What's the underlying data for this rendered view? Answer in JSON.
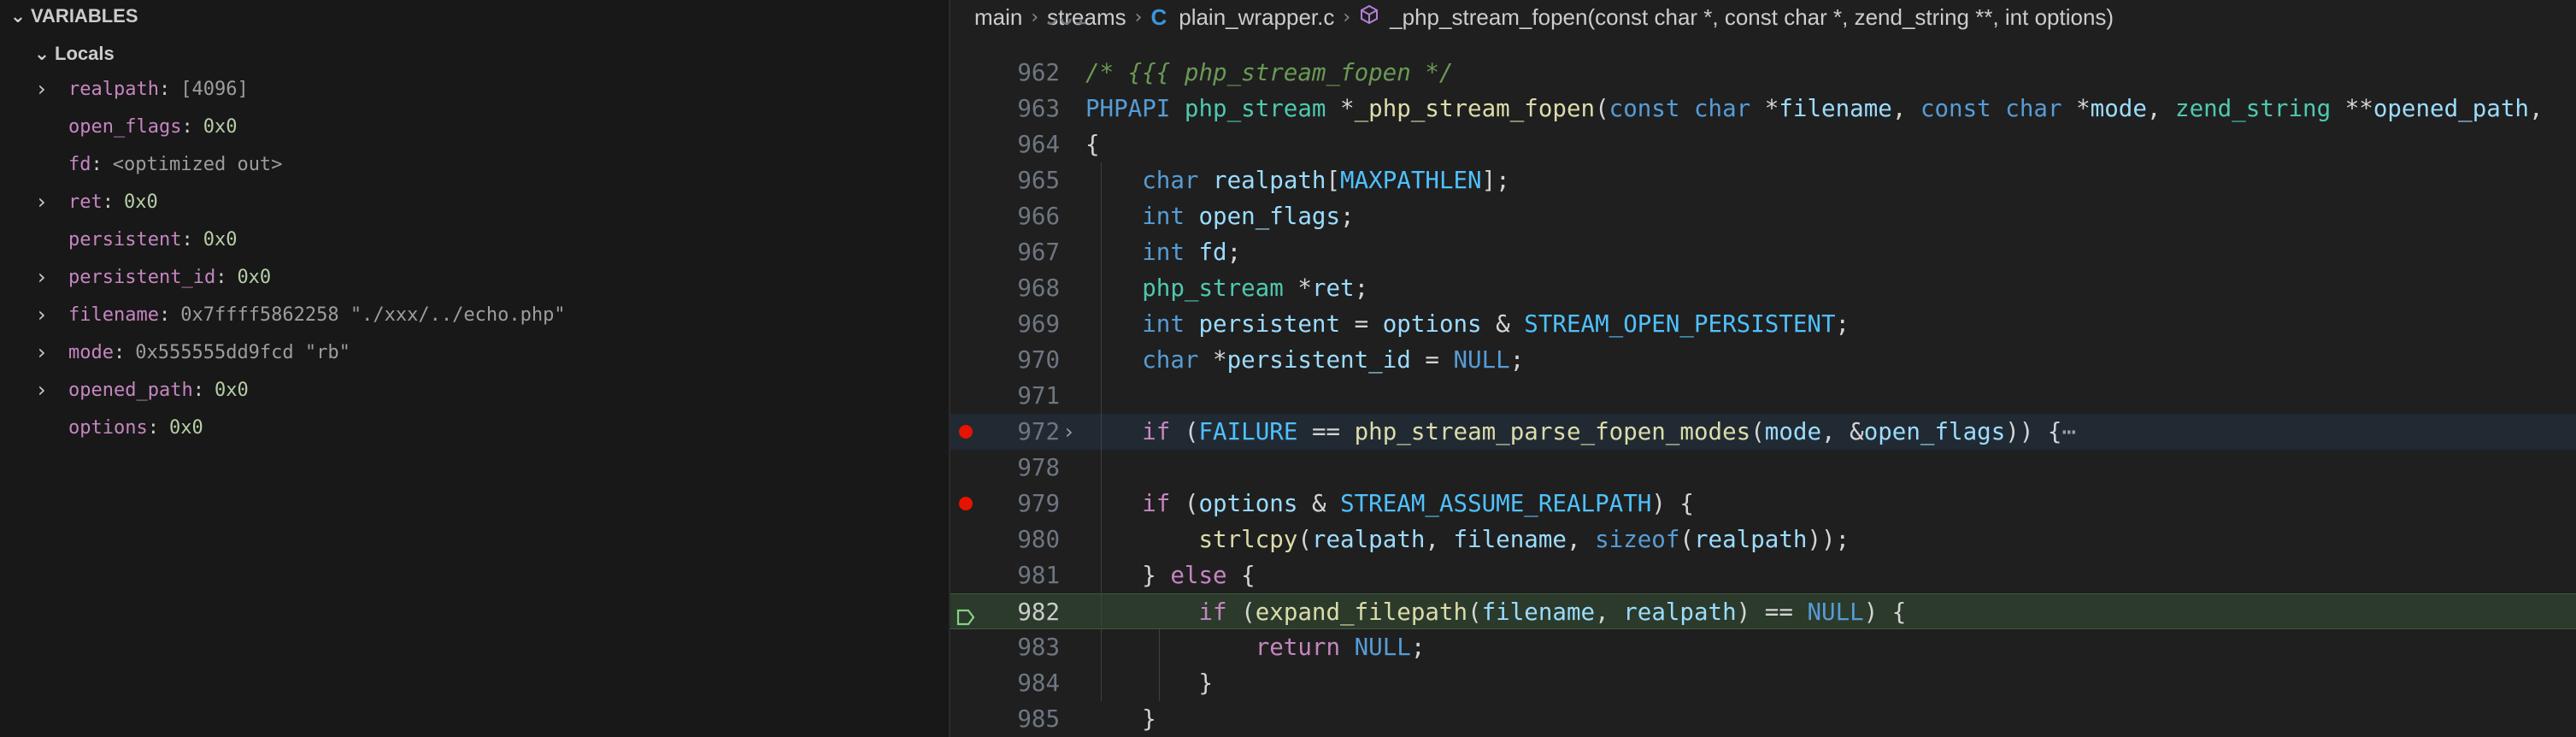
{
  "variables_panel": {
    "title": "VARIABLES",
    "scope": "Locals",
    "vars": [
      {
        "name": "realpath",
        "value": "[4096]",
        "expandable": true,
        "kind": "dim"
      },
      {
        "name": "open_flags",
        "value": "0x0",
        "expandable": false,
        "kind": "num"
      },
      {
        "name": "fd",
        "value": "<optimized out>",
        "expandable": false,
        "kind": "dim"
      },
      {
        "name": "ret",
        "value": "0x0",
        "expandable": true,
        "kind": "num"
      },
      {
        "name": "persistent",
        "value": "0x0",
        "expandable": false,
        "kind": "num"
      },
      {
        "name": "persistent_id",
        "value": "0x0",
        "expandable": true,
        "kind": "num"
      },
      {
        "name": "filename",
        "value": "0x7ffff5862258 \"./xxx/../echo.php\"",
        "expandable": true,
        "kind": "dim"
      },
      {
        "name": "mode",
        "value": "0x555555dd9fcd \"rb\"",
        "expandable": true,
        "kind": "dim"
      },
      {
        "name": "opened_path",
        "value": "0x0",
        "expandable": true,
        "kind": "num"
      },
      {
        "name": "options",
        "value": "0x0",
        "expandable": false,
        "kind": "num"
      }
    ]
  },
  "breadcrumb": {
    "items": [
      "main",
      "streams",
      "plain_wrapper.c",
      "_php_stream_fopen(const char *, const char *, zend_string **, int options)"
    ],
    "c_icon": "C"
  },
  "editor": {
    "partial_line_number": "961",
    "current_line": "982",
    "breakpoint_lines": [
      "972",
      "979"
    ],
    "lines": [
      {
        "n": "962",
        "tokens": [
          [
            "cm",
            "/* {{{ php_stream_fopen */"
          ]
        ]
      },
      {
        "n": "963",
        "tokens": [
          [
            "kw",
            "PHPAPI"
          ],
          [
            "pl",
            " "
          ],
          [
            "ty",
            "php_stream"
          ],
          [
            "pl",
            " *"
          ],
          [
            "fn",
            "_php_stream_fopen"
          ],
          [
            "pl",
            "("
          ],
          [
            "kw",
            "const"
          ],
          [
            "pl",
            " "
          ],
          [
            "kw",
            "char"
          ],
          [
            "pl",
            " *"
          ],
          [
            "id",
            "filename"
          ],
          [
            "pl",
            ", "
          ],
          [
            "kw",
            "const"
          ],
          [
            "pl",
            " "
          ],
          [
            "kw",
            "char"
          ],
          [
            "pl",
            " *"
          ],
          [
            "id",
            "mode"
          ],
          [
            "pl",
            ", "
          ],
          [
            "ty",
            "zend_string"
          ],
          [
            "pl",
            " **"
          ],
          [
            "id",
            "opened_path"
          ],
          [
            "pl",
            ","
          ]
        ]
      },
      {
        "n": "964",
        "tokens": [
          [
            "pl",
            "{"
          ]
        ]
      },
      {
        "n": "965",
        "tokens": [
          [
            "pl",
            "    "
          ],
          [
            "kw",
            "char"
          ],
          [
            "pl",
            " "
          ],
          [
            "id",
            "realpath"
          ],
          [
            "pl",
            "["
          ],
          [
            "mac",
            "MAXPATHLEN"
          ],
          [
            "pl",
            "];"
          ]
        ]
      },
      {
        "n": "966",
        "tokens": [
          [
            "pl",
            "    "
          ],
          [
            "kw",
            "int"
          ],
          [
            "pl",
            " "
          ],
          [
            "id",
            "open_flags"
          ],
          [
            "pl",
            ";"
          ]
        ]
      },
      {
        "n": "967",
        "tokens": [
          [
            "pl",
            "    "
          ],
          [
            "kw",
            "int"
          ],
          [
            "pl",
            " "
          ],
          [
            "id",
            "fd"
          ],
          [
            "pl",
            ";"
          ]
        ]
      },
      {
        "n": "968",
        "tokens": [
          [
            "pl",
            "    "
          ],
          [
            "ty",
            "php_stream"
          ],
          [
            "pl",
            " *"
          ],
          [
            "id",
            "ret"
          ],
          [
            "pl",
            ";"
          ]
        ]
      },
      {
        "n": "969",
        "tokens": [
          [
            "pl",
            "    "
          ],
          [
            "kw",
            "int"
          ],
          [
            "pl",
            " "
          ],
          [
            "id",
            "persistent"
          ],
          [
            "pl",
            " = "
          ],
          [
            "id",
            "options"
          ],
          [
            "pl",
            " & "
          ],
          [
            "mac",
            "STREAM_OPEN_PERSISTENT"
          ],
          [
            "pl",
            ";"
          ]
        ]
      },
      {
        "n": "970",
        "tokens": [
          [
            "pl",
            "    "
          ],
          [
            "kw",
            "char"
          ],
          [
            "pl",
            " *"
          ],
          [
            "id",
            "persistent_id"
          ],
          [
            "pl",
            " = "
          ],
          [
            "mac-k",
            "NULL"
          ],
          [
            "pl",
            ";"
          ]
        ]
      },
      {
        "n": "971",
        "tokens": []
      },
      {
        "n": "972",
        "tokens": [
          [
            "pl",
            "    "
          ],
          [
            "kw2",
            "if"
          ],
          [
            "pl",
            " ("
          ],
          [
            "mac",
            "FAILURE"
          ],
          [
            "pl",
            " == "
          ],
          [
            "fn",
            "php_stream_parse_fopen_modes"
          ],
          [
            "pl",
            "("
          ],
          [
            "id",
            "mode"
          ],
          [
            "pl",
            ", &"
          ],
          [
            "id",
            "open_flags"
          ],
          [
            "pl",
            ")) {"
          ],
          [
            "ell",
            "⋯"
          ]
        ]
      },
      {
        "n": "978",
        "tokens": []
      },
      {
        "n": "979",
        "tokens": [
          [
            "pl",
            "    "
          ],
          [
            "kw2",
            "if"
          ],
          [
            "pl",
            " ("
          ],
          [
            "id",
            "options"
          ],
          [
            "pl",
            " & "
          ],
          [
            "mac",
            "STREAM_ASSUME_REALPATH"
          ],
          [
            "pl",
            ") {"
          ]
        ]
      },
      {
        "n": "980",
        "tokens": [
          [
            "pl",
            "        "
          ],
          [
            "fn",
            "strlcpy"
          ],
          [
            "pl",
            "("
          ],
          [
            "id",
            "realpath"
          ],
          [
            "pl",
            ", "
          ],
          [
            "id",
            "filename"
          ],
          [
            "pl",
            ", "
          ],
          [
            "kw",
            "sizeof"
          ],
          [
            "pl",
            "("
          ],
          [
            "id",
            "realpath"
          ],
          [
            "pl",
            "));"
          ]
        ]
      },
      {
        "n": "981",
        "tokens": [
          [
            "pl",
            "    } "
          ],
          [
            "kw2",
            "else"
          ],
          [
            "pl",
            " {"
          ]
        ]
      },
      {
        "n": "982",
        "tokens": [
          [
            "pl",
            "        "
          ],
          [
            "kw2",
            "if"
          ],
          [
            "pl",
            " "
          ],
          [
            "pl",
            "("
          ],
          [
            "fn",
            "expand_filepath"
          ],
          [
            "pl",
            "("
          ],
          [
            "id",
            "filename"
          ],
          [
            "pl",
            ", "
          ],
          [
            "id",
            "realpath"
          ],
          [
            "pl",
            ") == "
          ],
          [
            "mac-k",
            "NULL"
          ],
          [
            "pl",
            ") {"
          ]
        ]
      },
      {
        "n": "983",
        "tokens": [
          [
            "pl",
            "            "
          ],
          [
            "kw2",
            "return"
          ],
          [
            "pl",
            " "
          ],
          [
            "mac-k",
            "NULL"
          ],
          [
            "pl",
            ";"
          ]
        ]
      },
      {
        "n": "984",
        "tokens": [
          [
            "pl",
            "        }"
          ]
        ]
      },
      {
        "n": "985",
        "tokens": [
          [
            "pl",
            "    }"
          ]
        ]
      }
    ]
  },
  "colors": {
    "breakpoint": "#e51400",
    "current_line_bg": "#2b3a2b",
    "stack_frame_icon": "#89d185"
  },
  "icons": [
    "chevron-down-icon",
    "chevron-right-icon",
    "c-file-icon",
    "function-symbol-icon",
    "breakpoint-icon",
    "stack-frame-icon",
    "fold-chevron-icon"
  ]
}
